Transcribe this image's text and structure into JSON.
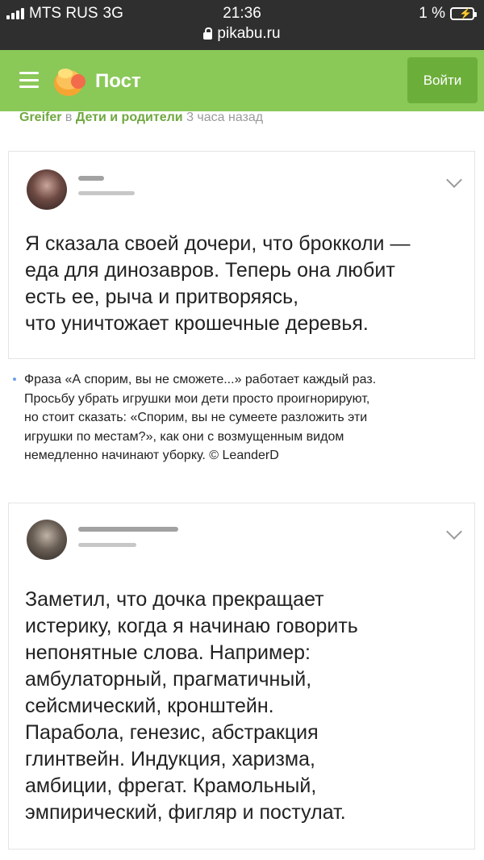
{
  "status_bar": {
    "carrier": "MTS RUS",
    "network": "3G",
    "time": "21:36",
    "battery": "1 %",
    "url": "pikabu.ru"
  },
  "header": {
    "menu_icon": "hamburger-icon",
    "logo_icon": "pikabu-logo-icon",
    "title": "Пост",
    "login_label": "Войти",
    "brand_color": "#8ac858"
  },
  "post_meta": {
    "author": "Greifer",
    "preposition": "в",
    "community": "Дети и родители",
    "time_ago": "3 часа назад"
  },
  "cards": [
    {
      "text": "Я сказала своей дочери, что брокколи —\nеда для динозавров. Теперь она любит\nесть ее, рыча и притворяясь,\nчто уничтожает крошечные деревья."
    },
    {
      "text": "Заметил, что дочка прекращает\nистерику, когда я начинаю говорить\nнепонятные слова. Например:\nамбулаторный, прагматичный,\nсейсмический, кронштейн.\nПарабола, генезис, абстракция\nглинтвейн. Индукция, харизма,\nамбиции, фрегат. Крамольный,\nэмпирический, фигляр и постулат."
    }
  ],
  "quote": {
    "lines": [
      "Фраза «А спорим, вы не сможете...» работает каждый раз.",
      "Просьбу убрать игрушки мои дети просто проигнорируют,",
      "но стоит сказать: «Спорим, вы не сумеете разложить эти",
      "игрушки по местам?», как они с возмущенным видом",
      "немедленно начинают уборку. © LeanderD"
    ]
  }
}
